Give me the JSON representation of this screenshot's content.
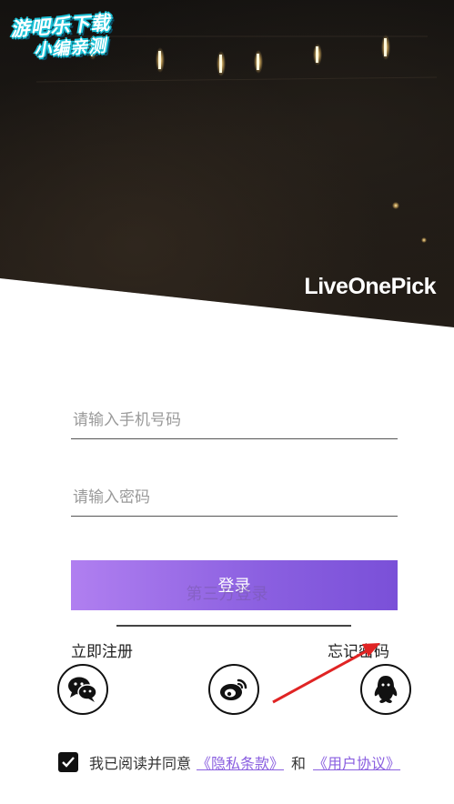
{
  "watermark": {
    "line1": "游吧乐下载",
    "line2": "小编亲测"
  },
  "hero": {
    "brand": "LiveOnePick"
  },
  "form": {
    "phone_placeholder": "请输入手机号码",
    "password_placeholder": "请输入密码",
    "login_label": "登录",
    "register_label": "立即注册",
    "forgot_label": "忘记密码"
  },
  "third_party": {
    "label": "第三方登录",
    "providers": [
      {
        "name": "WeChat",
        "icon": "wechat-icon"
      },
      {
        "name": "Weibo",
        "icon": "weibo-icon"
      },
      {
        "name": "QQ",
        "icon": "qq-icon"
      }
    ]
  },
  "agreement": {
    "checked": true,
    "prefix": "我已阅读并同意",
    "privacy_link": "《隐私条款》",
    "conjunction": "和",
    "terms_link": "《用户协议》"
  },
  "colors": {
    "accent": "#8a5fe0",
    "arrow": "#e02424"
  }
}
